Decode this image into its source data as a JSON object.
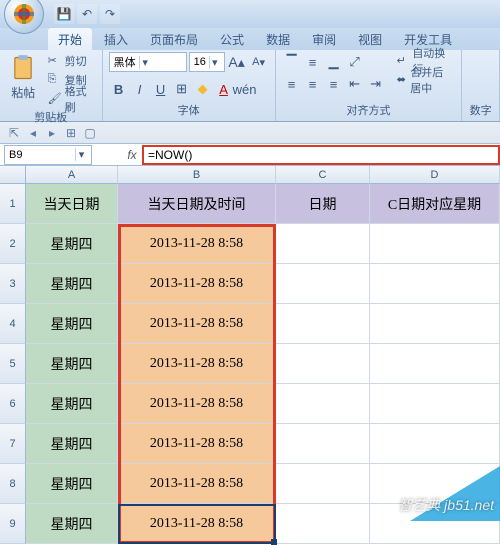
{
  "qat": {
    "save": "💾",
    "undo": "↶",
    "redo": "↷"
  },
  "tabs": [
    "开始",
    "插入",
    "页面布局",
    "公式",
    "数据",
    "审阅",
    "视图",
    "开发工具"
  ],
  "active_tab": 0,
  "ribbon": {
    "clipboard": {
      "paste": "粘帖",
      "cut": "剪切",
      "copy": "复制",
      "format": "格式刷",
      "label": "剪贴板"
    },
    "font": {
      "name": "黑体",
      "size": "16",
      "grow": "A",
      "shrink": "A",
      "bold": "B",
      "italic": "I",
      "underline": "U",
      "border": "⊞",
      "fill": "◆",
      "color": "A",
      "label": "字体"
    },
    "align": {
      "wrap": "自动换行",
      "merge": "合并后居中",
      "label": "对齐方式"
    },
    "number": {
      "label": "数字"
    }
  },
  "name_box": "B9",
  "fx_label": "fx",
  "formula": "=NOW()",
  "columns": [
    "A",
    "B",
    "C",
    "D"
  ],
  "header_row": {
    "A": "当天日期",
    "B": "当天日期及时间",
    "C": "日期",
    "D": "C日期对应星期"
  },
  "rows": [
    {
      "n": 2,
      "A": "星期四",
      "B": "2013-11-28 8:58",
      "C": "",
      "D": ""
    },
    {
      "n": 3,
      "A": "星期四",
      "B": "2013-11-28 8:58",
      "C": "",
      "D": ""
    },
    {
      "n": 4,
      "A": "星期四",
      "B": "2013-11-28 8:58",
      "C": "",
      "D": ""
    },
    {
      "n": 5,
      "A": "星期四",
      "B": "2013-11-28 8:58",
      "C": "",
      "D": ""
    },
    {
      "n": 6,
      "A": "星期四",
      "B": "2013-11-28 8:58",
      "C": "",
      "D": ""
    },
    {
      "n": 7,
      "A": "星期四",
      "B": "2013-11-28 8:58",
      "C": "",
      "D": ""
    },
    {
      "n": 8,
      "A": "星期四",
      "B": "2013-11-28 8:58",
      "C": "",
      "D": ""
    },
    {
      "n": 9,
      "A": "星期四",
      "B": "2013-11-28 8:58",
      "C": "",
      "D": ""
    }
  ],
  "watermark": "智艺典 jb51.net"
}
